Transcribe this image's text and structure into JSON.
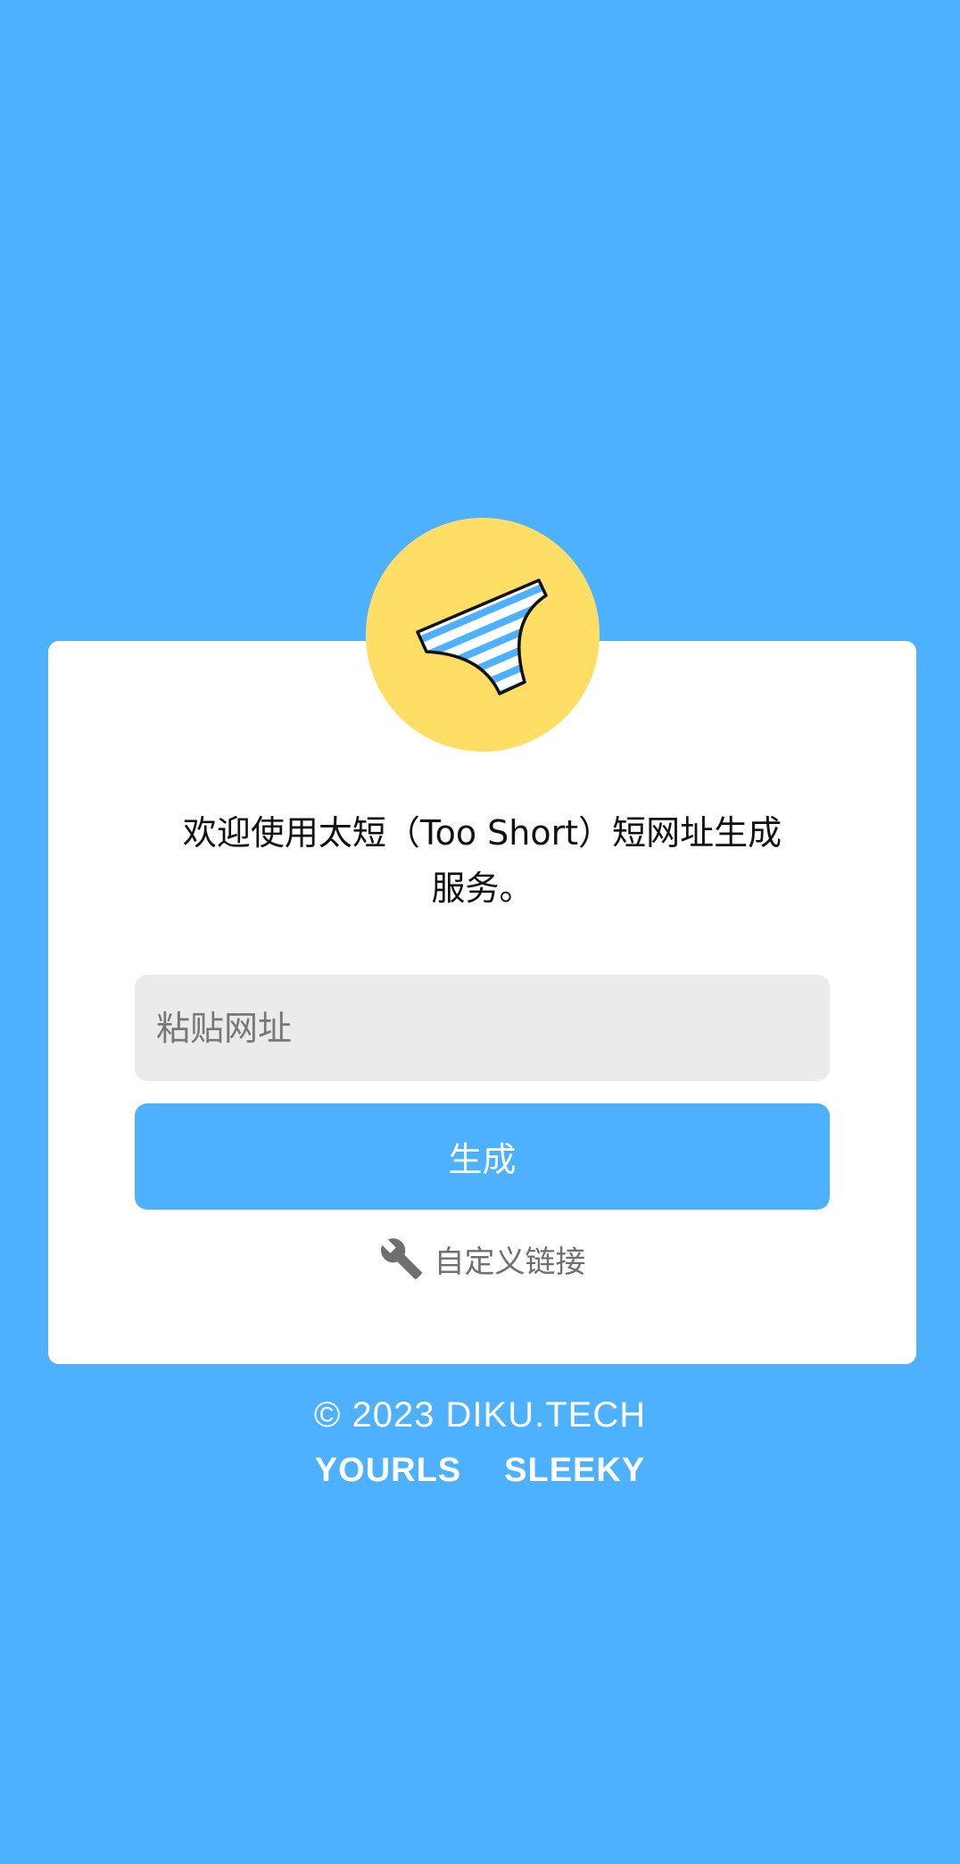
{
  "colors": {
    "background": "#4db1ff",
    "card": "#ffffff",
    "logo_circle": "#ffde66",
    "accent": "#4db1ff",
    "input_bg": "#ebebeb"
  },
  "logo": {
    "icon": "striped-underwear-icon"
  },
  "welcome": {
    "line1": "欢迎使用太短（Too Short）短网址生成",
    "line2": "服务。"
  },
  "form": {
    "url_placeholder": "粘贴网址",
    "url_value": "",
    "submit_label": "生成",
    "custom_link_icon": "wrench-icon",
    "custom_link_label": "自定义链接"
  },
  "footer": {
    "copyright": "© 2023 DIKU.TECH",
    "links": [
      "YOURLS",
      "SLEEKY"
    ]
  }
}
